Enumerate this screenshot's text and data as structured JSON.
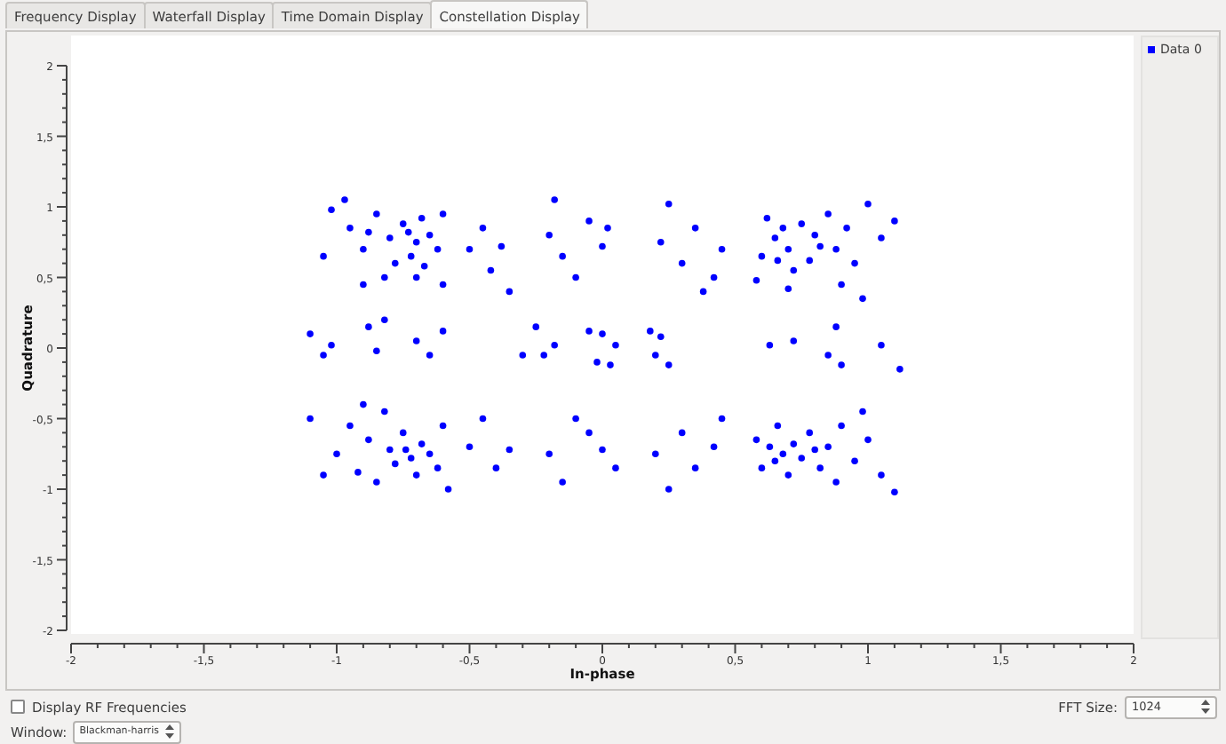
{
  "tabs": [
    {
      "label": "Frequency Display",
      "selected": false
    },
    {
      "label": "Waterfall Display",
      "selected": false
    },
    {
      "label": "Time Domain Display",
      "selected": false
    },
    {
      "label": "Constellation Display",
      "selected": true
    }
  ],
  "constellation": {
    "chart_data": {
      "type": "scatter",
      "xlabel": "In-phase",
      "ylabel": "Quadrature",
      "xlim": [
        -2,
        2
      ],
      "ylim": [
        -2,
        2
      ],
      "xticks": [
        {
          "value": -2,
          "label": "-2"
        },
        {
          "value": -1.5,
          "label": "-1,5"
        },
        {
          "value": -1,
          "label": "-1"
        },
        {
          "value": -0.5,
          "label": "-0,5"
        },
        {
          "value": 0,
          "label": "0"
        },
        {
          "value": 0.5,
          "label": "0,5"
        },
        {
          "value": 1,
          "label": "1"
        },
        {
          "value": 1.5,
          "label": "1,5"
        },
        {
          "value": 2,
          "label": "2"
        }
      ],
      "yticks": [
        {
          "value": -2,
          "label": "-2"
        },
        {
          "value": -1.5,
          "label": "-1,5"
        },
        {
          "value": -1,
          "label": "-1"
        },
        {
          "value": -0.5,
          "label": "-0,5"
        },
        {
          "value": 0,
          "label": "0"
        },
        {
          "value": 0.5,
          "label": "0,5"
        },
        {
          "value": 1,
          "label": "1"
        },
        {
          "value": 1.5,
          "label": "1,5"
        },
        {
          "value": 2,
          "label": "2"
        }
      ],
      "x": [
        -1.02,
        -0.95,
        -0.9,
        -0.85,
        -0.8,
        -0.75,
        -0.72,
        -0.7,
        -0.68,
        -0.65,
        -0.62,
        -0.6,
        -0.78,
        -0.88,
        -1.05,
        -0.97,
        -0.82,
        -0.7,
        -0.9,
        -0.6,
        -0.73,
        -0.67,
        -0.5,
        -0.45,
        -0.38,
        -0.35,
        -0.42,
        -0.2,
        -0.15,
        -0.18,
        -0.05,
        0,
        -0.1,
        0.02,
        0.22,
        0.25,
        0.3,
        0.35,
        0.38,
        0.45,
        0.42,
        0.6,
        0.62,
        0.65,
        0.68,
        0.7,
        0.72,
        0.75,
        0.78,
        0.8,
        0.85,
        0.88,
        0.92,
        0.95,
        1.0,
        1.05,
        1.1,
        0.9,
        0.98,
        0.7,
        0.58,
        0.82,
        0.66,
        -1.1,
        -1.05,
        -1.02,
        -0.88,
        -0.85,
        -0.82,
        -0.7,
        -0.65,
        -0.6,
        -0.25,
        -0.22,
        -0.18,
        0,
        -0.02,
        0.05,
        0.03,
        0.18,
        0.2,
        0.25,
        0.22,
        0.63,
        0.72,
        0.85,
        0.88,
        0.9,
        1.05,
        1.12,
        -0.3,
        -0.05,
        -1.0,
        -0.95,
        -0.92,
        -0.88,
        -0.85,
        -0.8,
        -0.78,
        -0.75,
        -0.72,
        -0.7,
        -0.68,
        -0.65,
        -0.62,
        -0.6,
        -0.58,
        -0.82,
        -1.05,
        -1.1,
        -0.74,
        -0.9,
        -0.5,
        -0.45,
        -0.4,
        -0.35,
        -0.2,
        -0.15,
        -0.05,
        0,
        0.05,
        -0.1,
        0.2,
        0.25,
        0.3,
        0.35,
        0.42,
        0.45,
        0.58,
        0.6,
        0.63,
        0.66,
        0.68,
        0.7,
        0.72,
        0.75,
        0.78,
        0.82,
        0.85,
        0.88,
        0.9,
        0.95,
        1.0,
        1.05,
        1.1,
        0.98,
        0.8,
        0.65
      ],
      "series": [
        {
          "name": "Data 0",
          "color": "#0000ff",
          "values": [
            0.98,
            0.85,
            0.7,
            0.95,
            0.78,
            0.88,
            0.65,
            0.75,
            0.92,
            0.8,
            0.7,
            0.95,
            0.6,
            0.82,
            0.65,
            1.05,
            0.5,
            0.5,
            0.45,
            0.45,
            0.82,
            0.58,
            0.7,
            0.85,
            0.72,
            0.4,
            0.55,
            0.8,
            0.65,
            1.05,
            0.9,
            0.72,
            0.5,
            0.85,
            0.75,
            1.02,
            0.6,
            0.85,
            0.4,
            0.7,
            0.5,
            0.65,
            0.92,
            0.78,
            0.85,
            0.7,
            0.55,
            0.88,
            0.62,
            0.8,
            0.95,
            0.7,
            0.85,
            0.6,
            1.02,
            0.78,
            0.9,
            0.45,
            0.35,
            0.42,
            0.48,
            0.72,
            0.62,
            0.1,
            -0.05,
            0.02,
            0.15,
            -0.02,
            0.2,
            0.05,
            -0.05,
            0.12,
            0.15,
            -0.05,
            0.02,
            0.1,
            -0.1,
            0.02,
            -0.12,
            0.12,
            -0.05,
            -0.12,
            0.08,
            0.02,
            0.05,
            -0.05,
            0.15,
            -0.12,
            0.02,
            -0.15,
            -0.05,
            0.12,
            -0.75,
            -0.55,
            -0.88,
            -0.65,
            -0.95,
            -0.72,
            -0.82,
            -0.6,
            -0.78,
            -0.9,
            -0.68,
            -0.75,
            -0.85,
            -0.55,
            -1.0,
            -0.45,
            -0.9,
            -0.5,
            -0.72,
            -0.4,
            -0.7,
            -0.5,
            -0.85,
            -0.72,
            -0.75,
            -0.95,
            -0.6,
            -0.72,
            -0.85,
            -0.5,
            -0.75,
            -1.0,
            -0.6,
            -0.85,
            -0.7,
            -0.5,
            -0.65,
            -0.85,
            -0.7,
            -0.55,
            -0.75,
            -0.9,
            -0.68,
            -0.78,
            -0.6,
            -0.85,
            -0.7,
            -0.95,
            -0.55,
            -0.8,
            -0.65,
            -0.9,
            -1.02,
            -0.45,
            -0.72,
            -0.8
          ]
        }
      ]
    }
  },
  "rf_frequencies": {
    "label": "Display RF Frequencies",
    "checked": false
  },
  "fft_size": {
    "label": "FFT Size:",
    "value": "1024"
  },
  "window": {
    "label": "Window:",
    "value": "Blackman-harris"
  }
}
